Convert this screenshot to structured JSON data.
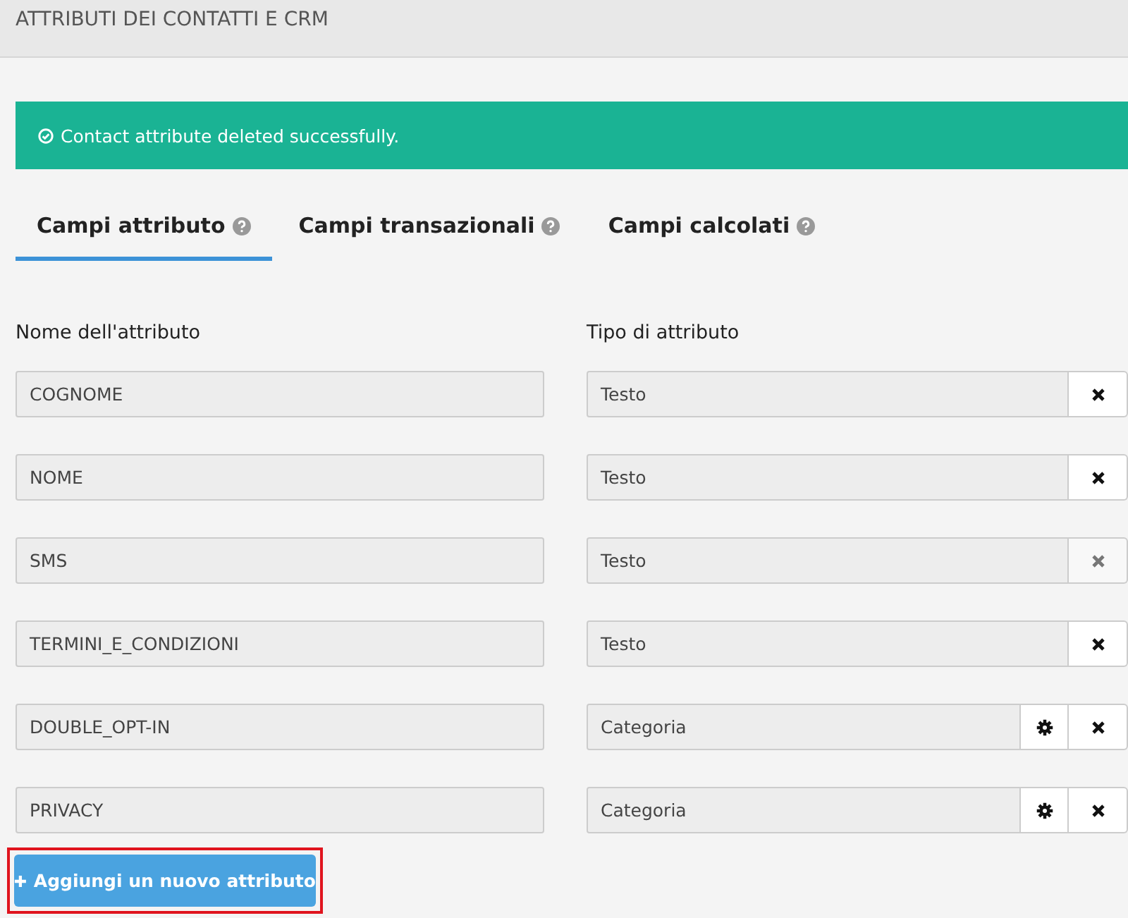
{
  "header": {
    "title": "ATTRIBUTI DEI CONTATTI E CRM"
  },
  "alert": {
    "text": "Contact attribute deleted successfully."
  },
  "tabs": [
    {
      "label": "Campi attributo",
      "selected": true
    },
    {
      "label": "Campi transazionali",
      "selected": false
    },
    {
      "label": "Campi calcolati",
      "selected": false
    }
  ],
  "columns": [
    "Nome dell'attributo",
    "Tipo di attributo"
  ],
  "rows": [
    {
      "name": "COGNOME",
      "type": "Testo",
      "settings": false,
      "delete_disabled": false
    },
    {
      "name": "NOME",
      "type": "Testo",
      "settings": false,
      "delete_disabled": false
    },
    {
      "name": "SMS",
      "type": "Testo",
      "settings": false,
      "delete_disabled": true
    },
    {
      "name": "TERMINI_E_CONDIZIONI",
      "type": "Testo",
      "settings": false,
      "delete_disabled": false
    },
    {
      "name": "DOUBLE_OPT-IN",
      "type": "Categoria",
      "settings": true,
      "delete_disabled": false
    },
    {
      "name": "PRIVACY",
      "type": "Categoria",
      "settings": true,
      "delete_disabled": false
    }
  ],
  "add_button": {
    "label": "Aggiungi un nuovo attributo",
    "highlighted": true
  }
}
